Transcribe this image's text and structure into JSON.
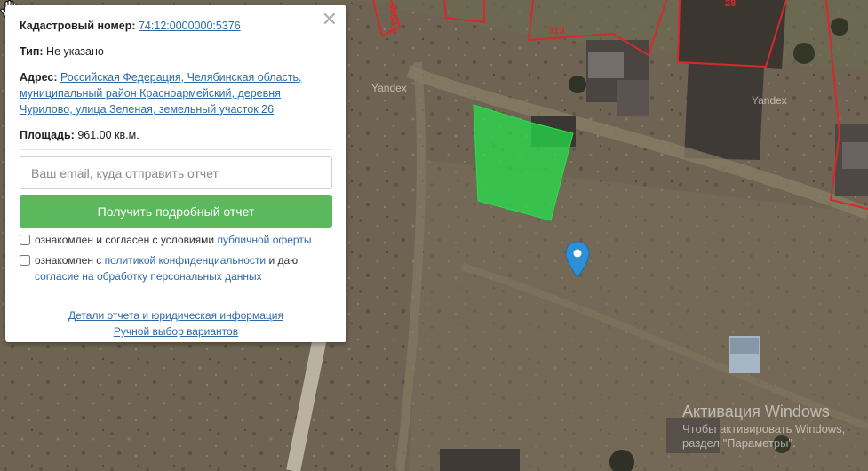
{
  "popup": {
    "cadastral_label": "Кадастровый номер:",
    "cadastral_number": "74:12:0000000:5376",
    "type_label": "Тип:",
    "type_value": "Не указано",
    "address_label": "Адрес:",
    "address_value": "Российская Федерация, Челябинская область, муниципальный район Красноармейский, деревня Чурилово, улица Зеленая, земельный участок 26",
    "area_label": "Площадь:",
    "area_value": "961.00 кв.м.",
    "email_placeholder": "Ваш email, куда отправить отчет",
    "email_value": "",
    "report_button": "Получить подробный отчет",
    "consent1_text": "ознакомлен и согласен с условиями",
    "consent1_link": "публичной оферты",
    "consent2_text": "ознакомлен с",
    "consent2_link": "политикой конфиденциальности",
    "consent2_and": "и даю",
    "consent2_link2": "согласие на обработку персональных данных",
    "details_link": "Детали отчета и юридическая информация",
    "manual_link": "Ручной выбор вариантов",
    "close_icon": "close-icon"
  },
  "map": {
    "parcel_labels": [
      "319",
      "28",
      "3664:2"
    ],
    "watermarks": [
      "Yandex",
      "Yandex"
    ],
    "highlight_color": "#22e34a",
    "marker_color": "#2d8fd5",
    "boundary_color": "#d42a2a"
  },
  "windows_activation": {
    "title": "Активация Windows",
    "line2": "Чтобы активировать Windows,",
    "line3": "раздел \"Параметры\"."
  }
}
